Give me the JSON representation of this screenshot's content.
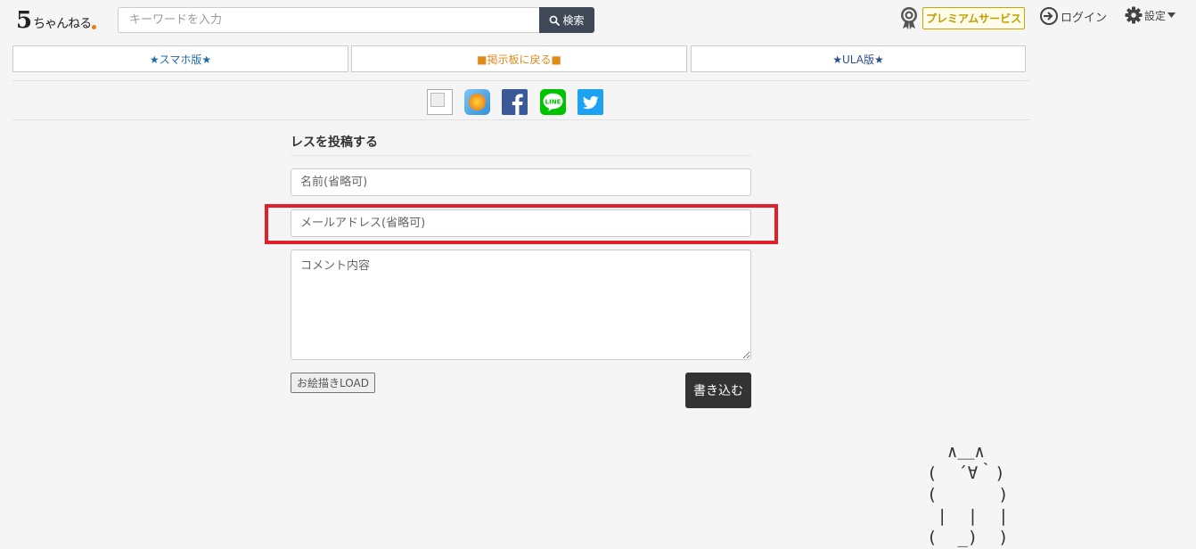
{
  "header": {
    "logo": {
      "main": "5",
      "rest": "ちゃんねる"
    },
    "search": {
      "placeholder": "キーワードを入力",
      "button_label": "検索"
    },
    "premium_label": "プレミアムサービス",
    "login_label": "ログイン",
    "settings_label": "設定"
  },
  "nav": {
    "smartphone_label": "★スマホ版★",
    "board_label": "■掲示板に戻る■",
    "ula_label": "★ULA版★"
  },
  "share": {
    "icons": [
      "broken-image-icon",
      "app-icon",
      "facebook-icon",
      "line-icon",
      "twitter-icon"
    ],
    "line_text": "LINE"
  },
  "form": {
    "title": "レスを投稿する",
    "name_placeholder": "名前(省略可)",
    "mail_placeholder": "メールアドレス(省略可)",
    "comment_placeholder": "コメント内容",
    "oekaki_label": "お絵描きLOAD",
    "submit_label": "書き込む"
  },
  "ascii_art": "  ∧＿∧\n(  ´∀｀)\n(      )\n |  |  |\n(  _)  )",
  "colors": {
    "search_button": "#3f4856",
    "highlight": "#e0202a",
    "premium": "#c09c00",
    "submit_button": "#333333"
  }
}
